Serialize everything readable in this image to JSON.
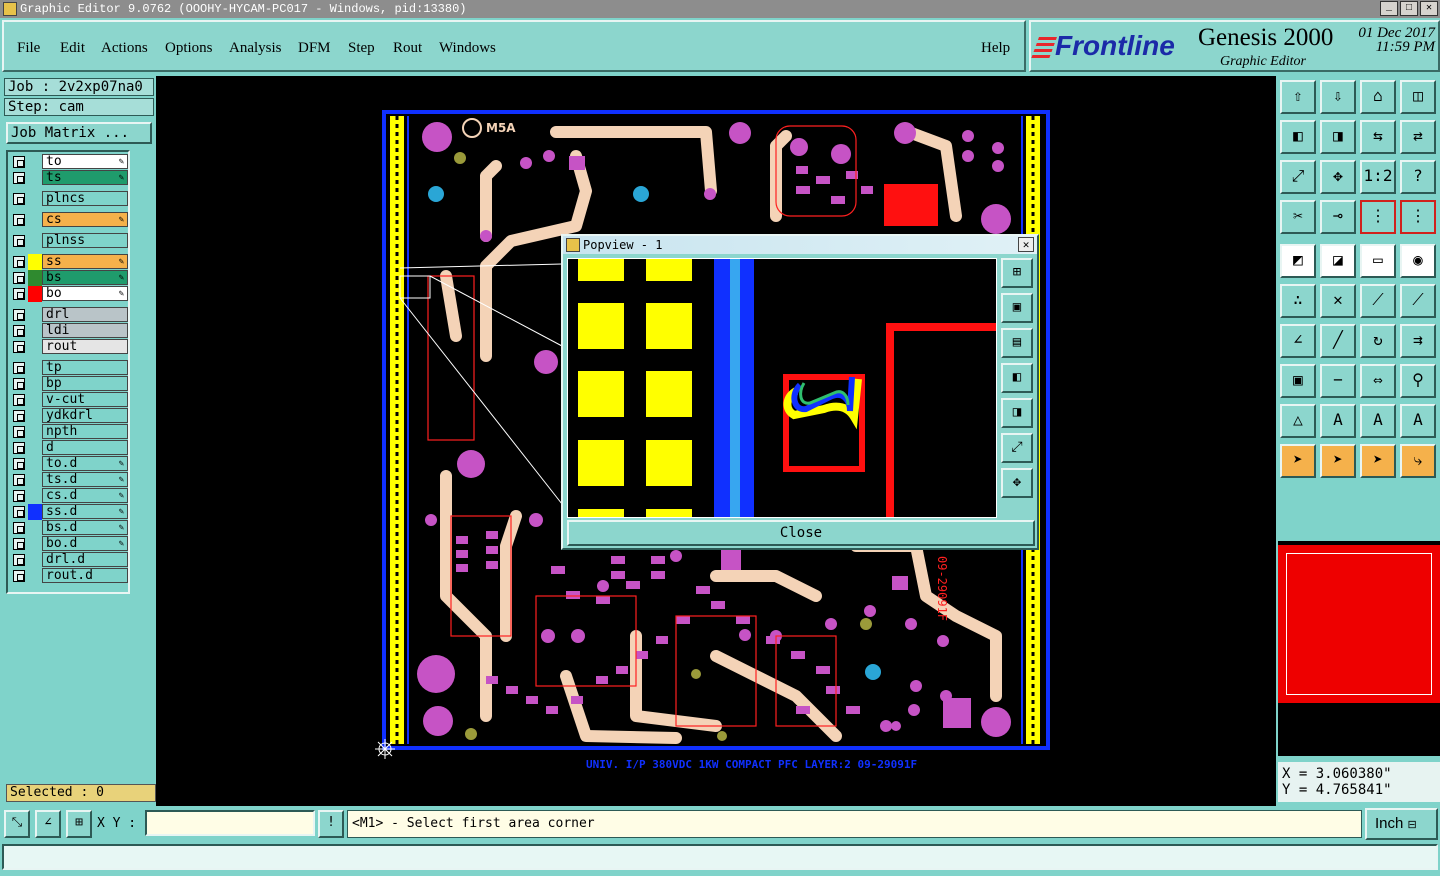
{
  "window": {
    "title": "Graphic Editor 9.0762 (OOOHY-HYCAM-PC017 - Windows, pid:13380)"
  },
  "menu": [
    "File",
    "Edit",
    "Actions",
    "Options",
    "Analysis",
    "DFM",
    "Step",
    "Rout",
    "Windows"
  ],
  "help": "Help",
  "brand": {
    "logo": "Frontline",
    "product": "Genesis 2000",
    "subtitle": "Graphic Editor",
    "date": "01 Dec 2017",
    "time": "11:59 PM"
  },
  "job": {
    "job": "Job : 2v2xp07na0",
    "step": "Step: cam",
    "matrix_button": "Job Matrix ..."
  },
  "layers": [
    {
      "name": "to",
      "color": "#ffffff",
      "swatch": ""
    },
    {
      "name": "ts",
      "color": "#1f9b6c",
      "swatch": ""
    },
    {
      "name": "plncs",
      "color": "#7fd3ca",
      "swatch": ""
    },
    {
      "name": "cs",
      "color": "#f5b14b",
      "swatch": ""
    },
    {
      "name": "plnss",
      "color": "#7fd3ca",
      "swatch": ""
    },
    {
      "name": "ss",
      "color": "#f5b14b",
      "swatch": "#ffff00"
    },
    {
      "name": "bs",
      "color": "#1f9b6c",
      "swatch": "#2f8a2f"
    },
    {
      "name": "bo",
      "color": "#ffffff",
      "swatch": "#ff0000"
    },
    {
      "name": "drl",
      "color": "#b9c4c8",
      "swatch": ""
    },
    {
      "name": "ldi",
      "color": "#b9c4c8",
      "swatch": ""
    },
    {
      "name": "rout",
      "color": "#e5e5e5",
      "swatch": ""
    },
    {
      "name": "tp",
      "color": "#7fd3ca",
      "swatch": ""
    },
    {
      "name": "bp",
      "color": "#7fd3ca",
      "swatch": ""
    },
    {
      "name": "v-cut",
      "color": "#7fd3ca",
      "swatch": ""
    },
    {
      "name": "ydkdrl",
      "color": "#7fd3ca",
      "swatch": ""
    },
    {
      "name": "npth",
      "color": "#7fd3ca",
      "swatch": ""
    },
    {
      "name": "d",
      "color": "#7fd3ca",
      "swatch": ""
    },
    {
      "name": "to.d",
      "color": "#7fd3ca",
      "swatch": ""
    },
    {
      "name": "ts.d",
      "color": "#7fd3ca",
      "swatch": ""
    },
    {
      "name": "cs.d",
      "color": "#7fd3ca",
      "swatch": ""
    },
    {
      "name": "ss.d",
      "color": "#7fd3ca",
      "swatch": "#1030ff"
    },
    {
      "name": "bs.d",
      "color": "#7fd3ca",
      "swatch": ""
    },
    {
      "name": "bo.d",
      "color": "#7fd3ca",
      "swatch": ""
    },
    {
      "name": "drl.d",
      "color": "#7fd3ca",
      "swatch": ""
    },
    {
      "name": "rout.d",
      "color": "#7fd3ca",
      "swatch": ""
    }
  ],
  "selected": "Selected : 0",
  "board_label": "UNIV. I/P 380VDC 1KW COMPACT PFC LAYER:2 09-29091F",
  "board_marks": {
    "logo": "M5A",
    "side_text": "09-29091F"
  },
  "popview": {
    "title": "Popview - 1",
    "close": "Close"
  },
  "coords": {
    "x": "X = 3.060380\"",
    "y": "Y = 4.765841\""
  },
  "bottom": {
    "xy_label": "X Y :",
    "prompt": "<M1> - Select first area corner",
    "unit": "Inch"
  },
  "icons": {
    "toolbar_top": [
      "home-out-icon",
      "home-in-icon",
      "house-icon",
      "split-view-icon",
      "prev-icon",
      "next-icon",
      "mirror-icon",
      "swap-icon",
      "fit-icon",
      "center-icon",
      "scale-1-2-icon",
      "help-icon",
      "ruler-icon",
      "single-pin-icon",
      "pins-icon",
      "pins-red-icon"
    ],
    "toolbar_mid": [
      "feature-icon",
      "line-icon",
      "measure-icon",
      "pad-icon",
      "connect-icon",
      "cross-icon",
      "point-icon",
      "point-red-icon",
      "angle-icon",
      "slash-icon",
      "rotate-icon",
      "ff-icon",
      "select-icon",
      "minus-icon",
      "dim-icon",
      "group-icon",
      "tri-icon",
      "tri-a-icon",
      "tri-a2-icon",
      "tri-a3-icon",
      "arrow-icon",
      "arrow-box-icon",
      "arrow-box2-icon",
      "arrow-path-icon"
    ]
  }
}
